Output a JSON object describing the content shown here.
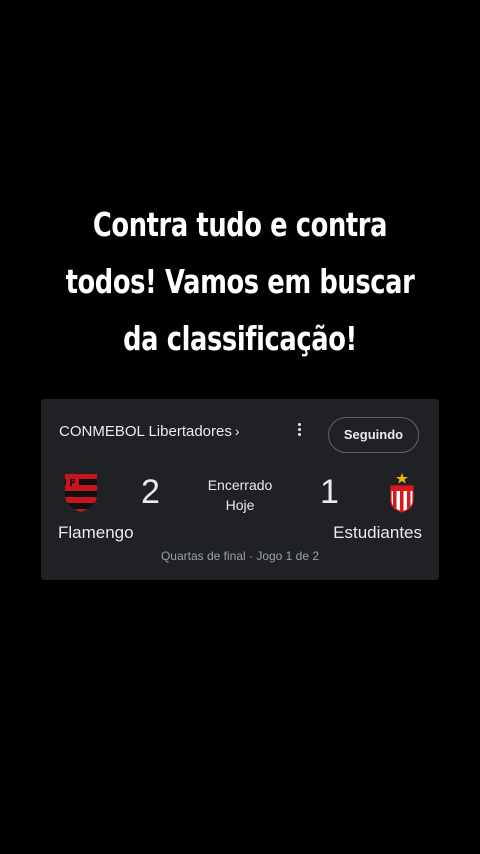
{
  "caption": {
    "lines": [
      "Contra tudo e contra",
      "todos! Vamos em buscar",
      "da classificação!"
    ]
  },
  "match_card": {
    "league": "CONMEBOL Libertadores",
    "league_chevron": "›",
    "more_icon": "more-vert-icon",
    "follow_label": "Seguindo",
    "status_line1": "Encerrado",
    "status_line2": "Hoje",
    "home": {
      "name": "Flamengo",
      "score": "2",
      "logo": "flamengo-crest-icon",
      "colors": [
        "#c4161c",
        "#111111"
      ]
    },
    "away": {
      "name": "Estudiantes",
      "score": "1",
      "logo": "estudiantes-crest-icon",
      "colors": [
        "#d71920",
        "#ffffff",
        "#f0b400"
      ]
    },
    "stage": "Quartas de final · Jogo 1 de 2"
  },
  "colors": {
    "background": "#000000",
    "card": "#202124",
    "text": "#e8eaed",
    "muted": "#9aa0a6"
  }
}
